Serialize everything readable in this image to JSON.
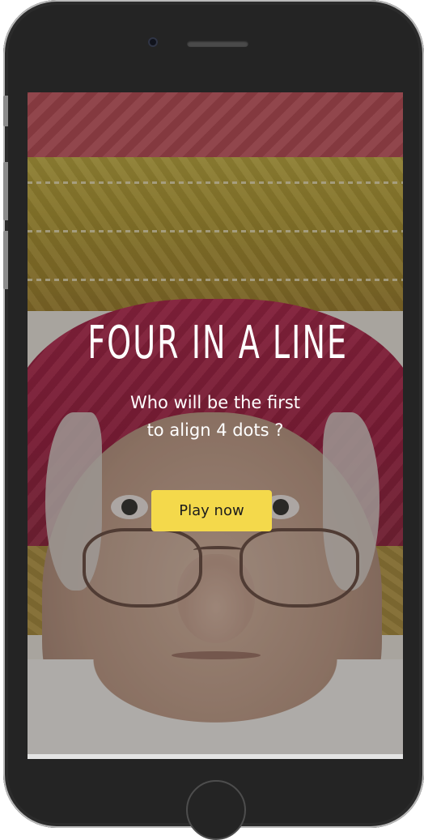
{
  "game": {
    "title": "FOUR IN A LINE",
    "subtitle_line1": "Who will be the first",
    "subtitle_line2": "to align 4 dots ?",
    "play_label": "Play now"
  },
  "colors": {
    "button_bg": "#f4d94b",
    "text": "#ffffff",
    "device_body": "#242424"
  },
  "icons": {
    "home": "home-button",
    "camera": "front-camera-icon",
    "speaker": "speaker-grille"
  }
}
